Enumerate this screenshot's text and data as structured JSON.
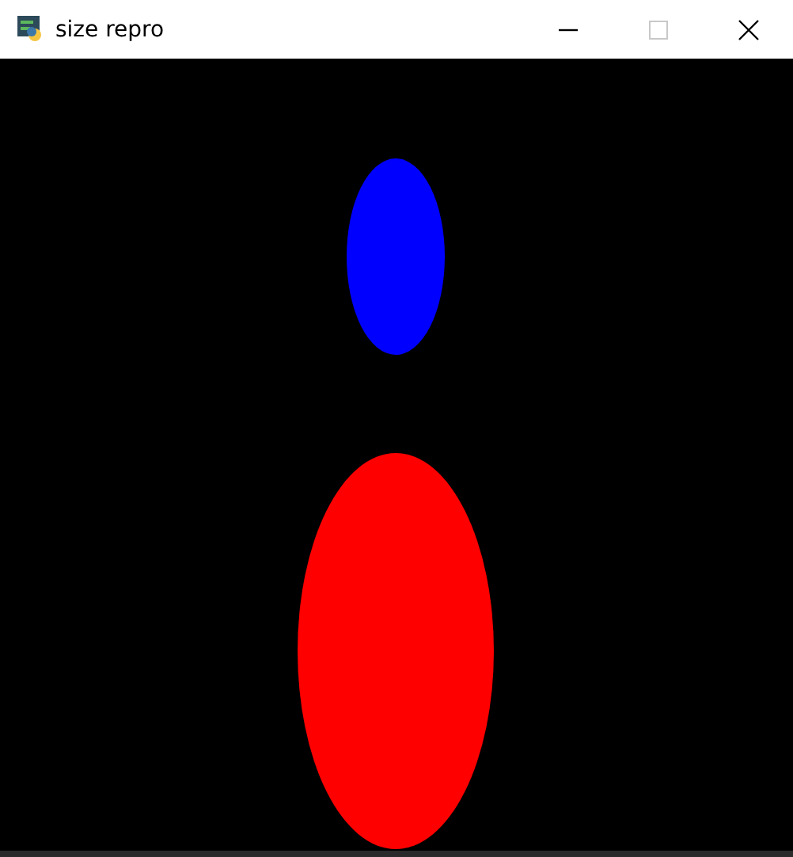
{
  "window": {
    "title": "size repro"
  },
  "title_buttons": [
    {
      "kind": "minimize",
      "disabled": false
    },
    {
      "kind": "maximize",
      "disabled": true
    },
    {
      "kind": "close",
      "disabled": false
    }
  ],
  "canvas": {
    "shapes": [
      {
        "kind": "ellipse",
        "color": "#0000ff"
      },
      {
        "kind": "ellipse",
        "color": "#ff0000"
      }
    ]
  }
}
